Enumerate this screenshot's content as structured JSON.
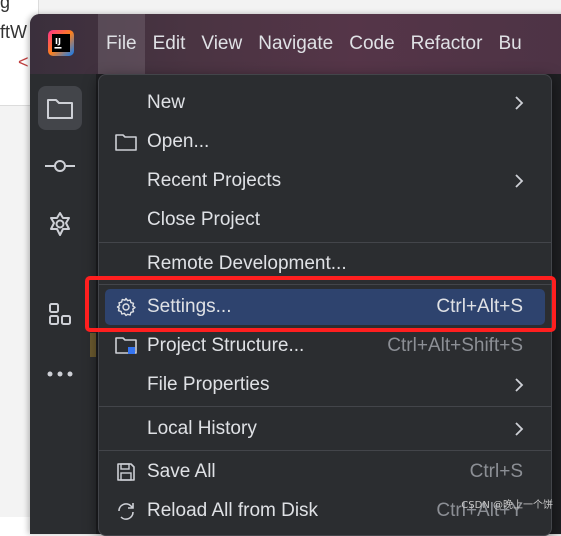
{
  "background": {
    "peek_text_1": "g",
    "peek_text_2": "ftW",
    "peek_text_3": "<"
  },
  "menubar": {
    "items": [
      {
        "label": "File",
        "active": true
      },
      {
        "label": "Edit"
      },
      {
        "label": "View"
      },
      {
        "label": "Navigate"
      },
      {
        "label": "Code"
      },
      {
        "label": "Refactor"
      },
      {
        "label": "Bu"
      }
    ]
  },
  "sidebar": {
    "icons": [
      "folder-icon",
      "commit-icon",
      "plugin-icon",
      "structure-icon",
      "more-icon"
    ]
  },
  "file_menu": {
    "items": [
      {
        "label": "New",
        "submenu": true
      },
      {
        "label": "Open...",
        "icon": "folder-icon"
      },
      {
        "label": "Recent Projects",
        "submenu": true
      },
      {
        "label": "Close Project"
      },
      {
        "label": "Remote Development..."
      },
      {
        "label": "Settings...",
        "shortcut": "Ctrl+Alt+S",
        "icon": "gear-icon",
        "selected": true
      },
      {
        "label": "Project Structure...",
        "shortcut": "Ctrl+Alt+Shift+S",
        "icon": "project-structure-icon"
      },
      {
        "label": "File Properties",
        "submenu": true
      },
      {
        "label": "Local History",
        "submenu": true
      },
      {
        "label": "Save All",
        "shortcut": "Ctrl+S",
        "icon": "save-icon"
      },
      {
        "label": "Reload All from Disk",
        "shortcut": "Ctrl+Alt+Y",
        "icon": "reload-icon"
      }
    ]
  },
  "watermark": "CSDN @晚上一个饼",
  "colors": {
    "accent_selected": "#2e436e",
    "highlight_box": "#ff1f1f"
  }
}
